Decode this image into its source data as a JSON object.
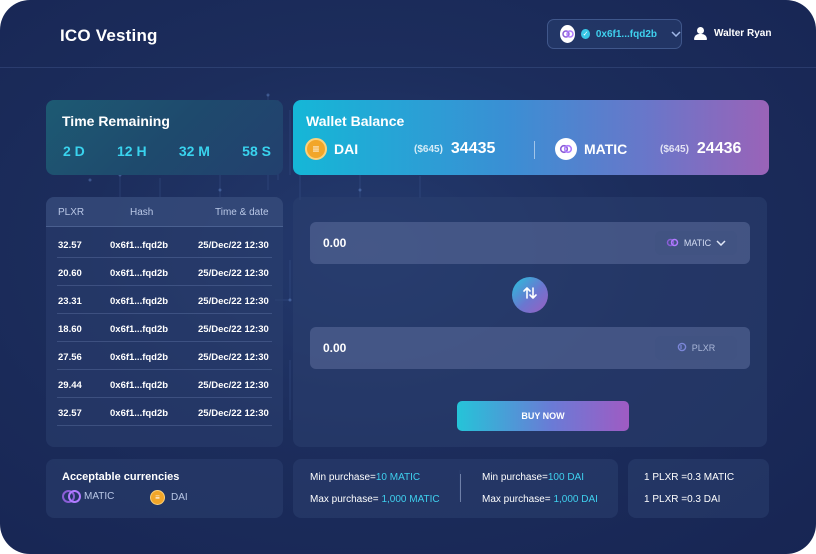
{
  "header": {
    "title": "ICO Vesting",
    "wallet_address": "0x6f1...fqd2b",
    "user_name": "Walter Ryan"
  },
  "time_remaining": {
    "label": "Time Remaining",
    "days": "2 D",
    "hours": "12 H",
    "minutes": "32 M",
    "seconds": "58 S"
  },
  "wallet_balance": {
    "label": "Wallet Balance",
    "items": [
      {
        "currency": "DAI",
        "usd": "($645)",
        "amount": "34435",
        "icon": "dai-icon"
      },
      {
        "currency": "MATIC",
        "usd": "($645)",
        "amount": "24436",
        "icon": "matic-icon"
      }
    ]
  },
  "history": {
    "columns": [
      "PLXR",
      "Hash",
      "Time & date"
    ],
    "rows": [
      {
        "plxr": "32.57",
        "hash": "0x6f1...fqd2b",
        "time": "25/Dec/22 12:30"
      },
      {
        "plxr": "20.60",
        "hash": "0x6f1...fqd2b",
        "time": "25/Dec/22 12:30"
      },
      {
        "plxr": "23.31",
        "hash": "0x6f1...fqd2b",
        "time": "25/Dec/22 12:30"
      },
      {
        "plxr": "18.60",
        "hash": "0x6f1...fqd2b",
        "time": "25/Dec/22 12:30"
      },
      {
        "plxr": "27.56",
        "hash": "0x6f1...fqd2b",
        "time": "25/Dec/22 12:30"
      },
      {
        "plxr": "29.44",
        "hash": "0x6f1...fqd2b",
        "time": "25/Dec/22 12:30"
      },
      {
        "plxr": "32.57",
        "hash": "0x6f1...fqd2b",
        "time": "25/Dec/22 12:30"
      }
    ]
  },
  "swap": {
    "from_value": "0.00",
    "from_currency": "MATIC",
    "to_value": "0.00",
    "to_currency": "PLXR",
    "buy_label": "BUY NOW"
  },
  "accepted": {
    "label": "Acceptable currencies",
    "items": [
      "MATIC",
      "DAI"
    ]
  },
  "limits": {
    "matic_min_label": "Min purchase=",
    "matic_min_value": "10 MATIC",
    "matic_max_label": "Max purchase= ",
    "matic_max_value": "1,000 MATIC",
    "dai_min_label": "Min purchase=",
    "dai_min_value": "100 DAI",
    "dai_max_label": "Max purchase= ",
    "dai_max_value": "1,000 DAI"
  },
  "rates": {
    "matic": "1 PLXR =0.3 MATIC",
    "dai": "1 PLXR =0.3 DAI"
  },
  "colors": {
    "accent": "#39d3ee",
    "background": "#1c2d5c",
    "dai": "#f2a629",
    "matic": "#8a5ed6"
  }
}
